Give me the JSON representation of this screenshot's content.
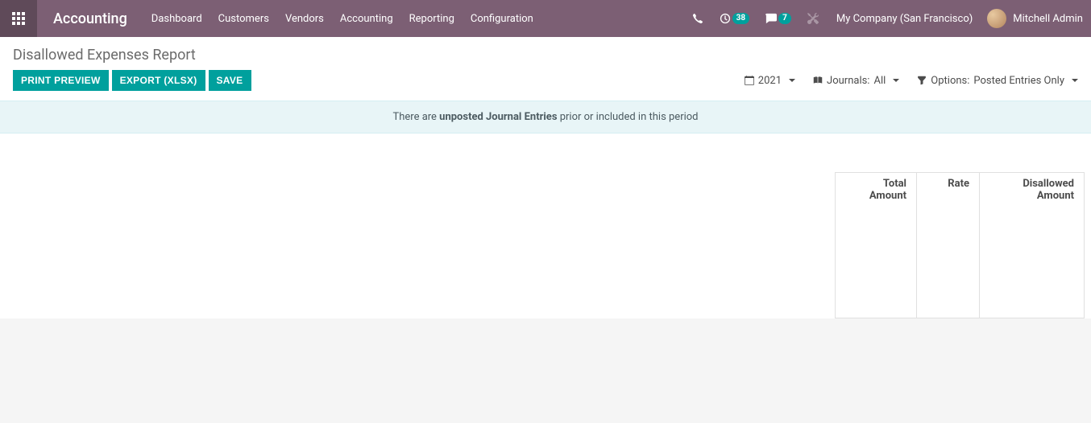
{
  "header": {
    "app_title": "Accounting",
    "menu": [
      "Dashboard",
      "Customers",
      "Vendors",
      "Accounting",
      "Reporting",
      "Configuration"
    ],
    "activities_count": "38",
    "messages_count": "7",
    "company": "My Company (San Francisco)",
    "user": "Mitchell Admin"
  },
  "page": {
    "title": "Disallowed Expenses Report",
    "buttons": {
      "print": "Print Preview",
      "export": "Export (XLSX)",
      "save": "Save"
    },
    "filters": {
      "year": "2021",
      "journals_label": "Journals:",
      "journals_value": "All",
      "options_label": "Options:",
      "options_value": "Posted Entries Only"
    },
    "alert": {
      "prefix": "There are ",
      "bold": "unposted Journal Entries",
      "suffix": " prior or included in this period"
    },
    "columns": {
      "total": "Total Amount",
      "rate": "Rate",
      "disallowed": "Disallowed Amount"
    }
  }
}
